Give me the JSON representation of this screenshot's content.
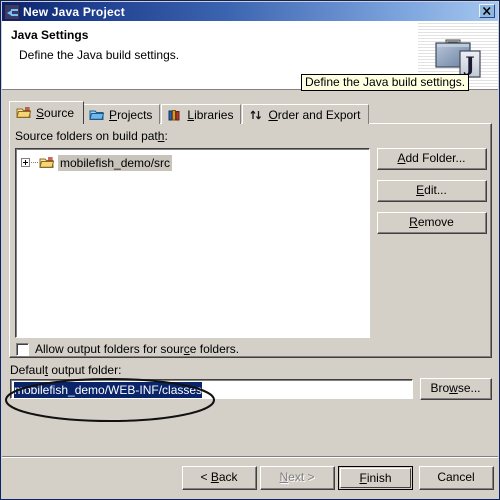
{
  "window": {
    "title": "New Java Project",
    "title_icon": "java-project-icon",
    "close_label": "✕"
  },
  "header": {
    "title": "Java Settings",
    "description": "Define the Java build settings.",
    "icon": "java-briefcase-icon",
    "icon_badge": "J"
  },
  "tooltip": {
    "text": "Define the Java build settings."
  },
  "tabs": [
    {
      "label": "Source",
      "icon": "source-folder-icon",
      "accel": "S",
      "active": true
    },
    {
      "label": "Projects",
      "icon": "project-folder-icon",
      "accel": "P",
      "active": false
    },
    {
      "label": "Libraries",
      "icon": "books-icon",
      "accel": "L",
      "active": false
    },
    {
      "label": "Order and Export",
      "icon": "updown-arrows-icon",
      "accel": "O",
      "active": false
    }
  ],
  "source_tab": {
    "list_label": "Source folders on build path:",
    "list_label_accel": "h",
    "tree_items": [
      {
        "label": "mobilefish_demo/src",
        "icon": "source-folder-icon",
        "expanded": false,
        "selected": true
      }
    ],
    "buttons": [
      {
        "label": "Add Folder...",
        "accel": "A",
        "enabled": true
      },
      {
        "label": "Edit...",
        "accel": "E",
        "enabled": true
      },
      {
        "label": "Remove",
        "accel": "R",
        "enabled": true
      }
    ],
    "checkbox": {
      "label": "Allow output folders for source folders.",
      "accel": "c",
      "checked": false
    }
  },
  "output_folder": {
    "label": "Default output folder:",
    "label_accel": "t",
    "value": "mobilefish_demo/WEB-INF/classes",
    "selected": true,
    "browse_label": "Browse...",
    "browse_accel": "w"
  },
  "annotation": {
    "shape": "ellipse",
    "color": "#111111",
    "target": "default-output-folder-field"
  },
  "footer_buttons": [
    {
      "label": "< Back",
      "accel": "B",
      "enabled": true,
      "default": false
    },
    {
      "label": "Next >",
      "accel": "N",
      "enabled": false,
      "default": false
    },
    {
      "label": "Finish",
      "accel": "F",
      "enabled": true,
      "default": true
    },
    {
      "label": "Cancel",
      "accel": "",
      "enabled": true,
      "default": false
    }
  ],
  "colors": {
    "dialog_face": "#d4d0c8",
    "title_gradient_start": "#0a246a",
    "title_gradient_end": "#a6c8ef",
    "selection": "#0a246a",
    "tooltip_bg": "#ffffe1"
  }
}
